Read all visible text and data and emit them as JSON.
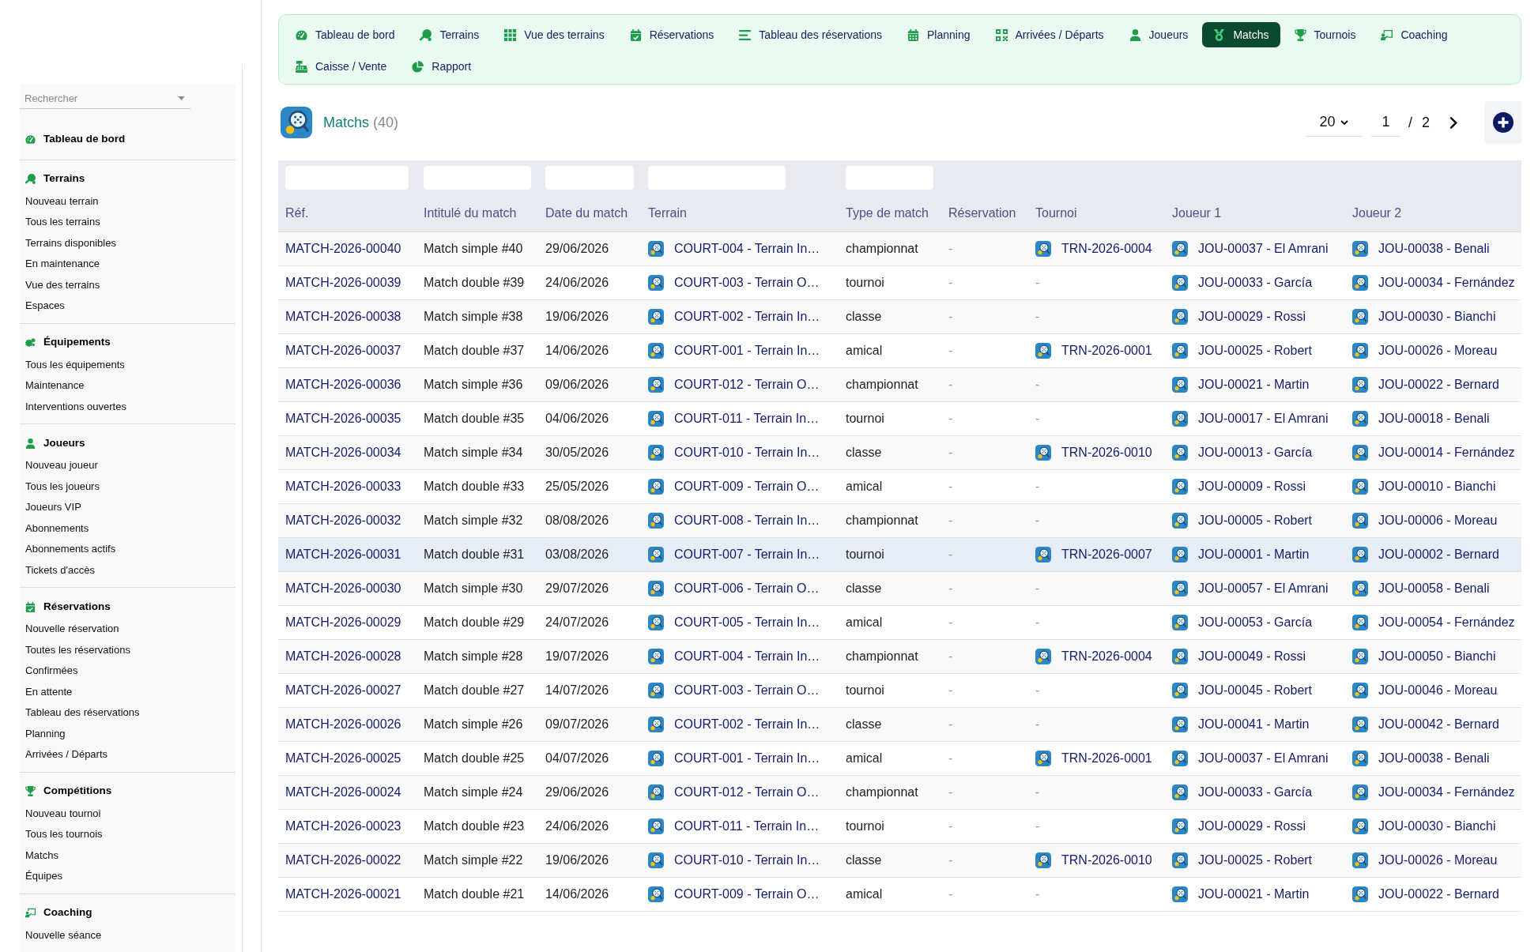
{
  "nav": {
    "items": [
      {
        "label": "Tableau de bord",
        "selected": false
      },
      {
        "label": "Terrains",
        "selected": false
      },
      {
        "label": "Vue des terrains",
        "selected": false
      },
      {
        "label": "Réservations",
        "selected": false
      },
      {
        "label": "Tableau des réservations",
        "selected": false
      },
      {
        "label": "Planning",
        "selected": false
      },
      {
        "label": "Arrivées / Départs",
        "selected": false
      },
      {
        "label": "Joueurs",
        "selected": false
      },
      {
        "label": "Matchs",
        "selected": true
      },
      {
        "label": "Tournois",
        "selected": false
      },
      {
        "label": "Coaching",
        "selected": false
      },
      {
        "label": "Caisse / Vente",
        "selected": false
      },
      {
        "label": "Rapport",
        "selected": false
      }
    ]
  },
  "sidebar": {
    "search": {
      "placeholder": "Rechercher"
    },
    "sections": [
      {
        "title": "Tableau de bord"
      },
      {
        "title": "Terrains",
        "items": [
          "Nouveau terrain",
          "Tous les terrains",
          "Terrains disponibles",
          "En maintenance",
          "Vue des terrains",
          "Espaces"
        ]
      },
      {
        "title": "Équipements",
        "items": [
          "Tous les équipements",
          "Maintenance",
          "Interventions ouvertes"
        ]
      },
      {
        "title": "Joueurs",
        "items": [
          "Nouveau joueur",
          "Tous les joueurs",
          "Joueurs VIP",
          "Abonnements",
          "Abonnements actifs",
          "Tickets d'accès"
        ]
      },
      {
        "title": "Réservations",
        "items": [
          "Nouvelle réservation",
          "Toutes les réservations",
          "Confirmées",
          "En attente",
          "Tableau des réservations",
          "Planning",
          "Arrivées / Départs"
        ]
      },
      {
        "title": "Compétitions",
        "items": [
          "Nouveau tournoi",
          "Tous les tournois",
          "Matchs",
          "Équipes"
        ]
      },
      {
        "title": "Coaching",
        "items": [
          "Nouvelle séance"
        ]
      }
    ]
  },
  "page_header": {
    "title": "Matchs",
    "count": "(40)",
    "page_size": "20",
    "page": "1",
    "separator": "/",
    "total_pages": "2"
  },
  "table": {
    "columns": [
      {
        "label": "Réf.",
        "filter": true
      },
      {
        "label": "Intitulé du match",
        "filter": true
      },
      {
        "label": "Date du match",
        "filter": true
      },
      {
        "label": "Terrain",
        "filter": true
      },
      {
        "label": "Type de match",
        "filter": true
      },
      {
        "label": "Réservation",
        "filter": false
      },
      {
        "label": "Tournoi",
        "filter": false
      },
      {
        "label": "Joueur 1",
        "filter": false
      },
      {
        "label": "Joueur 2",
        "filter": false
      }
    ],
    "rows": [
      {
        "ref": "MATCH-2026-00040",
        "title": "Match simple #40",
        "date": "29/06/2026",
        "court": "COURT-004 - Terrain In…",
        "type": "championnat",
        "reservation": "-",
        "tournament": {
          "text": "TRN-2026-0004",
          "linked": true
        },
        "player_1": "JOU-00037 - El Amrani",
        "player_2": "JOU-00038 - Benali",
        "selected": false
      },
      {
        "ref": "MATCH-2026-00039",
        "title": "Match double #39",
        "date": "24/06/2026",
        "court": "COURT-003 - Terrain O…",
        "type": "tournoi",
        "reservation": "-",
        "tournament": {
          "text": "-",
          "linked": false
        },
        "player_1": "JOU-00033 - García",
        "player_2": "JOU-00034 - Fernández",
        "selected": false
      },
      {
        "ref": "MATCH-2026-00038",
        "title": "Match simple #38",
        "date": "19/06/2026",
        "court": "COURT-002 - Terrain In…",
        "type": "classe",
        "reservation": "-",
        "tournament": {
          "text": "-",
          "linked": false
        },
        "player_1": "JOU-00029 - Rossi",
        "player_2": "JOU-00030 - Bianchi",
        "selected": false
      },
      {
        "ref": "MATCH-2026-00037",
        "title": "Match double #37",
        "date": "14/06/2026",
        "court": "COURT-001 - Terrain In…",
        "type": "amical",
        "reservation": "-",
        "tournament": {
          "text": "TRN-2026-0001",
          "linked": true
        },
        "player_1": "JOU-00025 - Robert",
        "player_2": "JOU-00026 - Moreau",
        "selected": false
      },
      {
        "ref": "MATCH-2026-00036",
        "title": "Match simple #36",
        "date": "09/06/2026",
        "court": "COURT-012 - Terrain O…",
        "type": "championnat",
        "reservation": "-",
        "tournament": {
          "text": "-",
          "linked": false
        },
        "player_1": "JOU-00021 - Martin",
        "player_2": "JOU-00022 - Bernard",
        "selected": false
      },
      {
        "ref": "MATCH-2026-00035",
        "title": "Match double #35",
        "date": "04/06/2026",
        "court": "COURT-011 - Terrain In…",
        "type": "tournoi",
        "reservation": "-",
        "tournament": {
          "text": "-",
          "linked": false
        },
        "player_1": "JOU-00017 - El Amrani",
        "player_2": "JOU-00018 - Benali",
        "selected": false
      },
      {
        "ref": "MATCH-2026-00034",
        "title": "Match simple #34",
        "date": "30/05/2026",
        "court": "COURT-010 - Terrain In…",
        "type": "classe",
        "reservation": "-",
        "tournament": {
          "text": "TRN-2026-0010",
          "linked": true
        },
        "player_1": "JOU-00013 - García",
        "player_2": "JOU-00014 - Fernández",
        "selected": false
      },
      {
        "ref": "MATCH-2026-00033",
        "title": "Match double #33",
        "date": "25/05/2026",
        "court": "COURT-009 - Terrain O…",
        "type": "amical",
        "reservation": "-",
        "tournament": {
          "text": "-",
          "linked": false
        },
        "player_1": "JOU-00009 - Rossi",
        "player_2": "JOU-00010 - Bianchi",
        "selected": false
      },
      {
        "ref": "MATCH-2026-00032",
        "title": "Match simple #32",
        "date": "08/08/2026",
        "court": "COURT-008 - Terrain In…",
        "type": "championnat",
        "reservation": "-",
        "tournament": {
          "text": "-",
          "linked": false
        },
        "player_1": "JOU-00005 - Robert",
        "player_2": "JOU-00006 - Moreau",
        "selected": false
      },
      {
        "ref": "MATCH-2026-00031",
        "title": "Match double #31",
        "date": "03/08/2026",
        "court": "COURT-007 - Terrain In…",
        "type": "tournoi",
        "reservation": "-",
        "tournament": {
          "text": "TRN-2026-0007",
          "linked": true
        },
        "player_1": "JOU-00001 - Martin",
        "player_2": "JOU-00002 - Bernard",
        "selected": true
      },
      {
        "ref": "MATCH-2026-00030",
        "title": "Match simple #30",
        "date": "29/07/2026",
        "court": "COURT-006 - Terrain O…",
        "type": "classe",
        "reservation": "-",
        "tournament": {
          "text": "-",
          "linked": false
        },
        "player_1": "JOU-00057 - El Amrani",
        "player_2": "JOU-00058 - Benali",
        "selected": false
      },
      {
        "ref": "MATCH-2026-00029",
        "title": "Match double #29",
        "date": "24/07/2026",
        "court": "COURT-005 - Terrain In…",
        "type": "amical",
        "reservation": "-",
        "tournament": {
          "text": "-",
          "linked": false
        },
        "player_1": "JOU-00053 - García",
        "player_2": "JOU-00054 - Fernández",
        "selected": false
      },
      {
        "ref": "MATCH-2026-00028",
        "title": "Match simple #28",
        "date": "19/07/2026",
        "court": "COURT-004 - Terrain In…",
        "type": "championnat",
        "reservation": "-",
        "tournament": {
          "text": "TRN-2026-0004",
          "linked": true
        },
        "player_1": "JOU-00049 - Rossi",
        "player_2": "JOU-00050 - Bianchi",
        "selected": false
      },
      {
        "ref": "MATCH-2026-00027",
        "title": "Match double #27",
        "date": "14/07/2026",
        "court": "COURT-003 - Terrain O…",
        "type": "tournoi",
        "reservation": "-",
        "tournament": {
          "text": "-",
          "linked": false
        },
        "player_1": "JOU-00045 - Robert",
        "player_2": "JOU-00046 - Moreau",
        "selected": false
      },
      {
        "ref": "MATCH-2026-00026",
        "title": "Match simple #26",
        "date": "09/07/2026",
        "court": "COURT-002 - Terrain In…",
        "type": "classe",
        "reservation": "-",
        "tournament": {
          "text": "-",
          "linked": false
        },
        "player_1": "JOU-00041 - Martin",
        "player_2": "JOU-00042 - Bernard",
        "selected": false
      },
      {
        "ref": "MATCH-2026-00025",
        "title": "Match double #25",
        "date": "04/07/2026",
        "court": "COURT-001 - Terrain In…",
        "type": "amical",
        "reservation": "-",
        "tournament": {
          "text": "TRN-2026-0001",
          "linked": true
        },
        "player_1": "JOU-00037 - El Amrani",
        "player_2": "JOU-00038 - Benali",
        "selected": false
      },
      {
        "ref": "MATCH-2026-00024",
        "title": "Match simple #24",
        "date": "29/06/2026",
        "court": "COURT-012 - Terrain O…",
        "type": "championnat",
        "reservation": "-",
        "tournament": {
          "text": "-",
          "linked": false
        },
        "player_1": "JOU-00033 - García",
        "player_2": "JOU-00034 - Fernández",
        "selected": false
      },
      {
        "ref": "MATCH-2026-00023",
        "title": "Match double #23",
        "date": "24/06/2026",
        "court": "COURT-011 - Terrain In…",
        "type": "tournoi",
        "reservation": "-",
        "tournament": {
          "text": "-",
          "linked": false
        },
        "player_1": "JOU-00029 - Rossi",
        "player_2": "JOU-00030 - Bianchi",
        "selected": false
      },
      {
        "ref": "MATCH-2026-00022",
        "title": "Match simple #22",
        "date": "19/06/2026",
        "court": "COURT-010 - Terrain In…",
        "type": "classe",
        "reservation": "-",
        "tournament": {
          "text": "TRN-2026-0010",
          "linked": true
        },
        "player_1": "JOU-00025 - Robert",
        "player_2": "JOU-00026 - Moreau",
        "selected": false
      },
      {
        "ref": "MATCH-2026-00021",
        "title": "Match double #21",
        "date": "14/06/2026",
        "court": "COURT-009 - Terrain O…",
        "type": "amical",
        "reservation": "-",
        "tournament": {
          "text": "-",
          "linked": false
        },
        "player_1": "JOU-00021 - Martin",
        "player_2": "JOU-00022 - Bernard",
        "selected": false
      }
    ]
  }
}
